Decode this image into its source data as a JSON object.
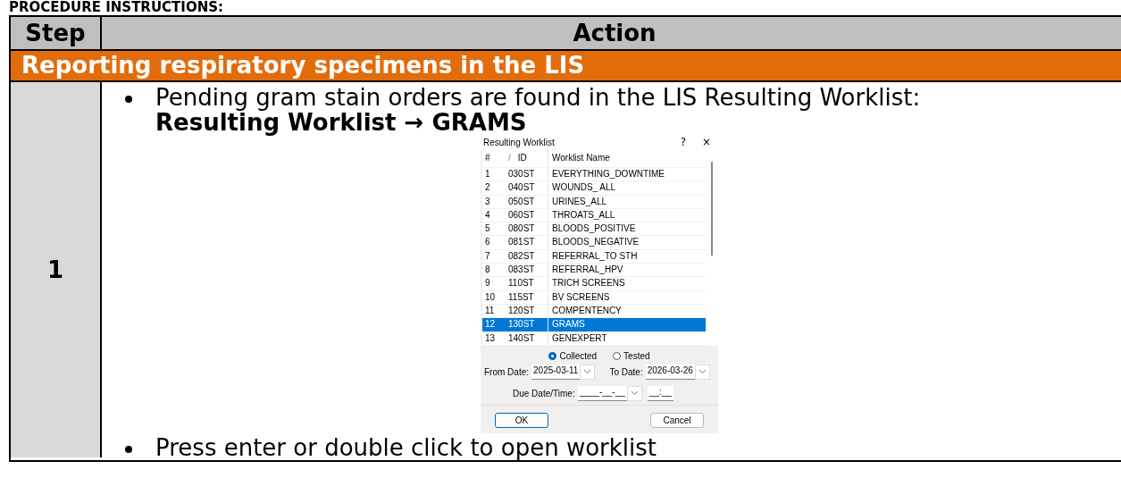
{
  "heading": "PROCEDURE INSTRUCTIONS:",
  "table": {
    "columns": [
      "Step",
      "Action"
    ],
    "section": "Reporting respiratory specimens in the LIS",
    "steps": [
      {
        "number": "1",
        "content": [
          {
            "kind": "bullet",
            "text": "Pending gram stain orders are found in the LIS Resulting Worklist: **Resulting Worklist → GRAMS**"
          },
          {
            "kind": "dialog",
            "dialog": {
              "title": "Resulting Worklist",
              "help": "?",
              "close": "×",
              "columns": [
                "#",
                "/",
                "ID",
                "Worklist Name"
              ],
              "rows": [
                {
                  "num": "1",
                  "id": "030ST",
                  "name": "EVERYTHING_DOWNTIME",
                  "selected": false
                },
                {
                  "num": "2",
                  "id": "040ST",
                  "name": "WOUNDS_ ALL",
                  "selected": false
                },
                {
                  "num": "3",
                  "id": "050ST",
                  "name": "URINES_ALL",
                  "selected": false
                },
                {
                  "num": "4",
                  "id": "060ST",
                  "name": "THROATS_ALL",
                  "selected": false
                },
                {
                  "num": "5",
                  "id": "080ST",
                  "name": "BLOODS_POSITIVE",
                  "selected": false
                },
                {
                  "num": "6",
                  "id": "081ST",
                  "name": "BLOODS_NEGATIVE",
                  "selected": false
                },
                {
                  "num": "7",
                  "id": "082ST",
                  "name": "REFERRAL_TO STH",
                  "selected": false
                },
                {
                  "num": "8",
                  "id": "083ST",
                  "name": "REFERRAL_HPV",
                  "selected": false
                },
                {
                  "num": "9",
                  "id": "110ST",
                  "name": "TRICH SCREENS",
                  "selected": false
                },
                {
                  "num": "10",
                  "id": "115ST",
                  "name": "BV SCREENS",
                  "selected": false
                },
                {
                  "num": "11",
                  "id": "120ST",
                  "name": "COMPENTENCY",
                  "selected": false
                },
                {
                  "num": "12",
                  "id": "130ST",
                  "name": "GRAMS",
                  "selected": true
                },
                {
                  "num": "13",
                  "id": "140ST",
                  "name": "GENEXPERT",
                  "selected": false
                }
              ],
              "radios": [
                {
                  "label": "Collected",
                  "selected": true
                },
                {
                  "label": "Tested",
                  "selected": false
                }
              ],
              "from_label": "From Date:",
              "from_value": "2025-03-11",
              "to_label": "To Date:",
              "to_value": "2026-03-26",
              "due_label": "Due Date/Time:",
              "due_date": "____-__-__",
              "due_time": "__:__",
              "buttons": [
                "OK",
                "Cancel"
              ]
            }
          },
          {
            "kind": "bullet",
            "text": "Press enter or double click to open worklist"
          }
        ]
      }
    ]
  }
}
